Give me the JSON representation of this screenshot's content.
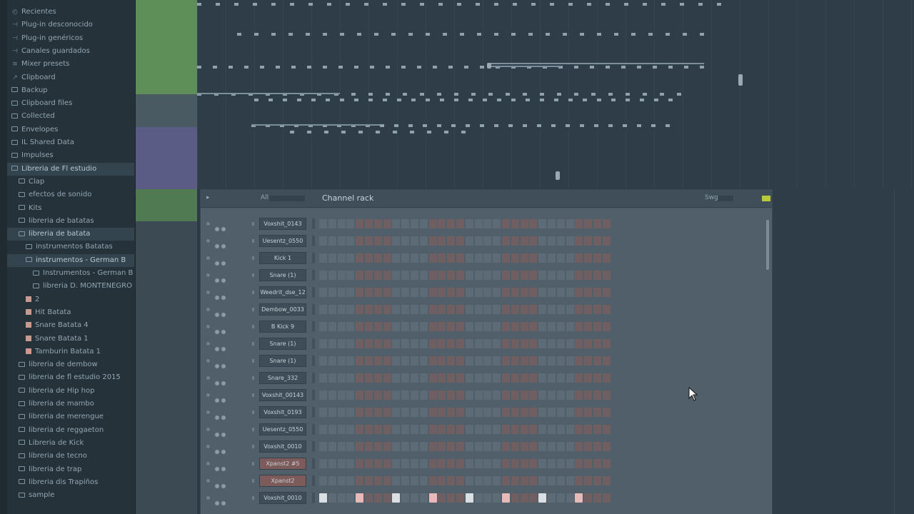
{
  "browser": {
    "items": [
      {
        "label": "Recientes",
        "icon": "clock-icon",
        "indent": 1,
        "highlight": false
      },
      {
        "label": "Plug-in desconocido",
        "icon": "plugin-icon",
        "indent": 1,
        "highlight": false
      },
      {
        "label": "Plug-in genéricos",
        "icon": "plugin-icon",
        "indent": 1,
        "highlight": false
      },
      {
        "label": "Canales guardados",
        "icon": "plugin-icon",
        "indent": 1,
        "highlight": false
      },
      {
        "label": "Mixer presets",
        "icon": "mixer-icon",
        "indent": 1,
        "highlight": false
      },
      {
        "label": "Clipboard",
        "icon": "clip-icon",
        "indent": 1,
        "highlight": false
      },
      {
        "label": "Backup",
        "icon": "folder-icon",
        "indent": 1,
        "highlight": false
      },
      {
        "label": "Clipboard files",
        "icon": "folder-icon",
        "indent": 1,
        "highlight": false
      },
      {
        "label": "Collected",
        "icon": "folder-icon",
        "indent": 1,
        "highlight": false
      },
      {
        "label": "Envelopes",
        "icon": "folder-icon",
        "indent": 1,
        "highlight": false
      },
      {
        "label": "IL Shared Data",
        "icon": "folder-icon",
        "indent": 1,
        "highlight": false
      },
      {
        "label": "Impulses",
        "icon": "folder-icon",
        "indent": 1,
        "highlight": false
      },
      {
        "label": "Libreria de Fl estudio",
        "icon": "folder-icon",
        "indent": 1,
        "highlight": true
      },
      {
        "label": "Clap",
        "icon": "folder-icon",
        "indent": 2,
        "highlight": false
      },
      {
        "label": "efectos de sonido",
        "icon": "folder-icon",
        "indent": 2,
        "highlight": false
      },
      {
        "label": "Kits",
        "icon": "folder-icon",
        "indent": 2,
        "highlight": false
      },
      {
        "label": "libreria de batatas",
        "icon": "folder-icon",
        "indent": 2,
        "highlight": false
      },
      {
        "label": "libreria de batata",
        "icon": "folder-icon",
        "indent": 2,
        "highlight": true
      },
      {
        "label": "instrumentos Batatas",
        "icon": "folder-icon",
        "indent": 3,
        "highlight": false
      },
      {
        "label": "instrumentos - German B",
        "icon": "folder-icon",
        "indent": 3,
        "highlight": true
      },
      {
        "label": "Instrumentos - German B",
        "icon": "folder-icon",
        "indent": 4,
        "highlight": false
      },
      {
        "label": "libreria D. MONTENEGRO",
        "icon": "folder-icon",
        "indent": 4,
        "highlight": false
      },
      {
        "label": "2",
        "icon": "file-icon",
        "indent": 3,
        "highlight": false
      },
      {
        "label": "Hit Batata",
        "icon": "file-icon",
        "indent": 3,
        "highlight": false
      },
      {
        "label": "Snare Batata 4",
        "icon": "file-icon",
        "indent": 3,
        "highlight": false
      },
      {
        "label": "Snare Batata 1",
        "icon": "file-icon",
        "indent": 3,
        "highlight": false
      },
      {
        "label": "Tamburin Batata 1",
        "icon": "file-icon",
        "indent": 3,
        "highlight": false
      },
      {
        "label": "libreria de dembow",
        "icon": "folder-icon",
        "indent": 2,
        "highlight": false
      },
      {
        "label": "libreria de fl estudio 2015",
        "icon": "folder-icon",
        "indent": 2,
        "highlight": false
      },
      {
        "label": "libreria de Hip hop",
        "icon": "folder-icon",
        "indent": 2,
        "highlight": false
      },
      {
        "label": "libreria de mambo",
        "icon": "folder-icon",
        "indent": 2,
        "highlight": false
      },
      {
        "label": "libreria de merengue",
        "icon": "folder-icon",
        "indent": 2,
        "highlight": false
      },
      {
        "label": "libreria de reggaeton",
        "icon": "folder-icon",
        "indent": 2,
        "highlight": false
      },
      {
        "label": "Libreria de Kick",
        "icon": "folder-icon",
        "indent": 2,
        "highlight": false
      },
      {
        "label": "libreria de tecno",
        "icon": "folder-icon",
        "indent": 2,
        "highlight": false
      },
      {
        "label": "libreria de trap",
        "icon": "folder-icon",
        "indent": 2,
        "highlight": false
      },
      {
        "label": "libreria dis Trapiños",
        "icon": "folder-icon",
        "indent": 2,
        "highlight": false
      },
      {
        "label": "sample",
        "icon": "folder-icon",
        "indent": 2,
        "highlight": false
      }
    ]
  },
  "rack": {
    "arrow": "▸",
    "filter_label": "All",
    "title": "Channel rack",
    "swing_label": "Swg",
    "channels": [
      {
        "name": "Voxshit_0143",
        "red": false,
        "pattern": []
      },
      {
        "name": "Uesentz_0550",
        "red": false,
        "pattern": []
      },
      {
        "name": "Kick 1",
        "red": false,
        "pattern": []
      },
      {
        "name": "Snare (1)",
        "red": false,
        "pattern": []
      },
      {
        "name": "Weedrit_dse_12",
        "red": false,
        "pattern": []
      },
      {
        "name": "Dembow_0033",
        "red": false,
        "pattern": []
      },
      {
        "name": "B Kick 9",
        "red": false,
        "pattern": []
      },
      {
        "name": "Snare (1)",
        "red": false,
        "pattern": []
      },
      {
        "name": "Snare (1)",
        "red": false,
        "pattern": []
      },
      {
        "name": "Snare_332",
        "red": false,
        "pattern": []
      },
      {
        "name": "Voxshit_00143",
        "red": false,
        "pattern": []
      },
      {
        "name": "Voxshit_0193",
        "red": false,
        "pattern": []
      },
      {
        "name": "Uesentz_0550",
        "red": false,
        "pattern": []
      },
      {
        "name": "Voxshit_0010",
        "red": false,
        "pattern": []
      },
      {
        "name": "Xpanst2 #5",
        "red": true,
        "pattern": []
      },
      {
        "name": "Xpanst2",
        "red": true,
        "pattern": []
      },
      {
        "name": "Voxshit_0010",
        "red": false,
        "pattern": [
          0,
          4,
          8,
          12,
          16,
          20,
          24,
          28
        ]
      }
    ]
  },
  "colors": {
    "sidebar_bg": "#25323a",
    "playlist_bg": "#2e3d47",
    "rack_bg": "#505f69",
    "accent_lime": "#b9c93b",
    "track_green": "#5e8f59",
    "track_purple": "#5b5c86",
    "track_mauve": "#6e5a6a"
  }
}
